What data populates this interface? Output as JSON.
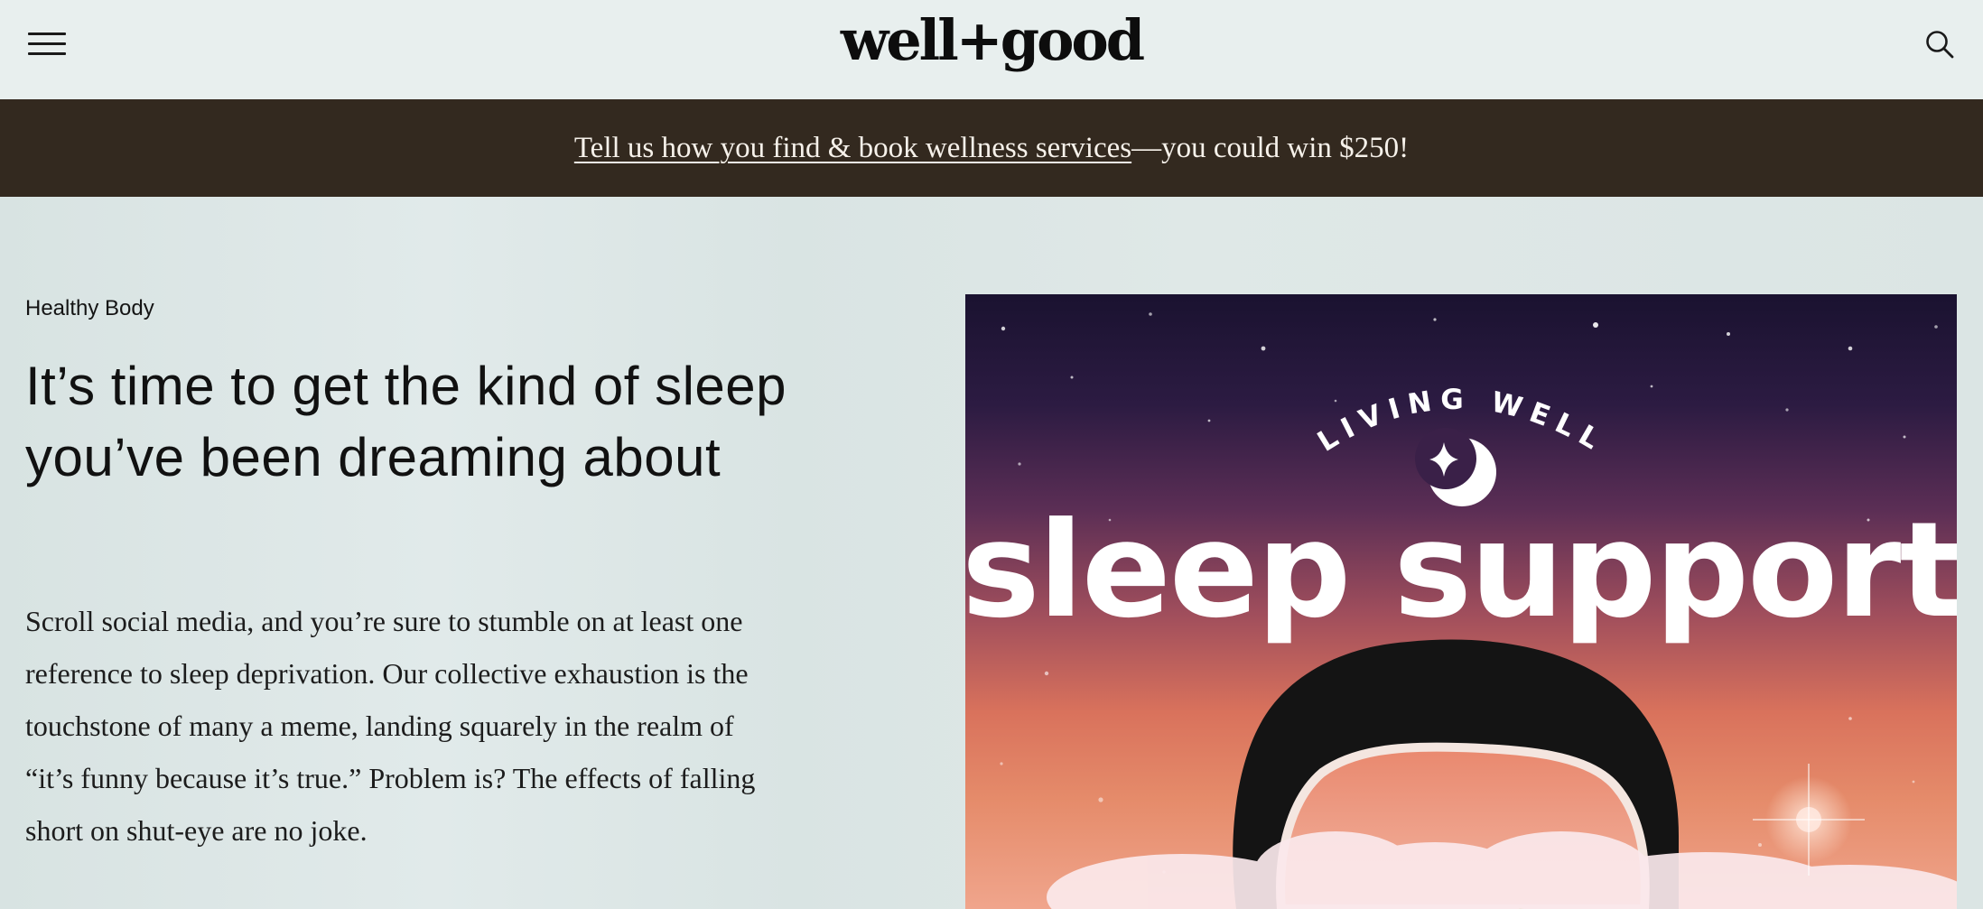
{
  "header": {
    "logo": "well+good",
    "menu_icon": "hamburger-menu-icon",
    "search_icon": "search-icon"
  },
  "promo": {
    "link_text": "Tell us how you find & book wellness services",
    "suffix_text": "—you could win $250!"
  },
  "article": {
    "category": "Healthy Body",
    "headline": "It’s time to get the kind of sleep you’ve been dreaming about",
    "intro": "Scroll social media, and you’re sure to stumble on at least one reference to sleep deprivation. Our collective exhaustion is the touchstone of many a meme, landing squarely in the realm of “it’s funny because it’s true.” Problem is? The effects of falling short on shut-eye are no joke."
  },
  "hero": {
    "kicker": "LIVING WELL",
    "title": "sleep support",
    "icons": [
      "moon-icon",
      "sparkle-icon"
    ]
  },
  "colors": {
    "header_bg": "#e8efee",
    "banner_bg": "#33291f",
    "banner_text": "#f6f1ea",
    "page_bg": "#dfe8e7",
    "text": "#111111"
  }
}
